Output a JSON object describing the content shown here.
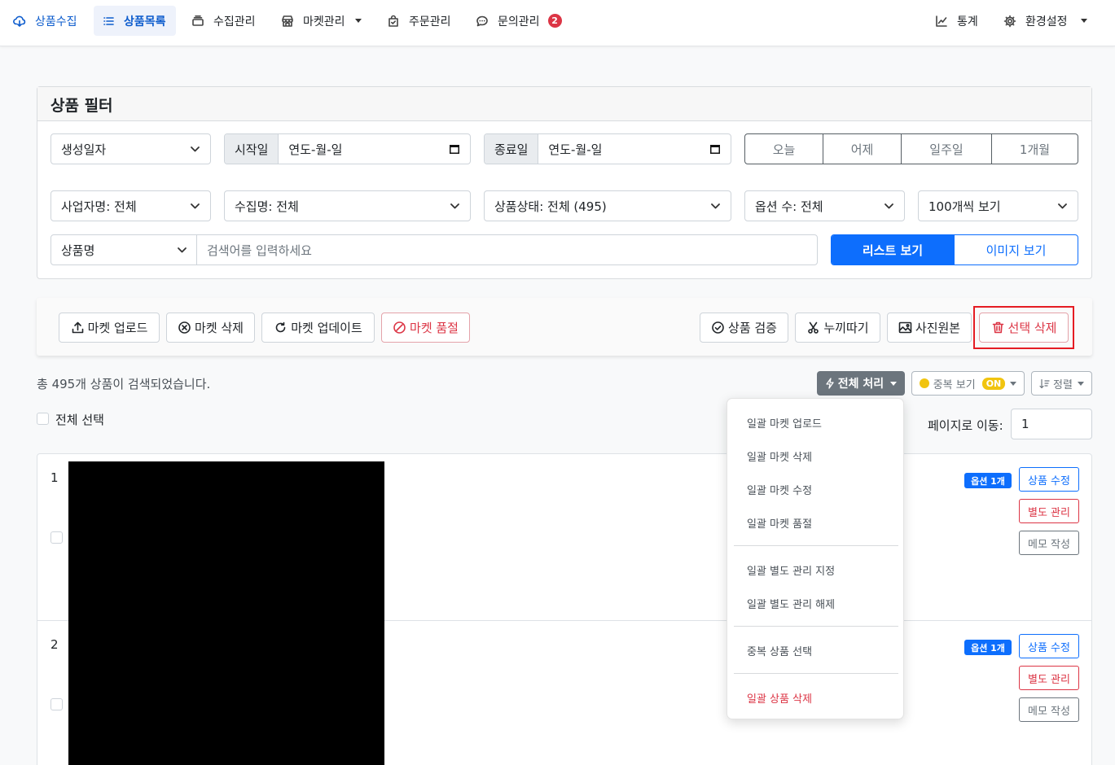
{
  "nav": {
    "items": [
      {
        "label": "상품수집",
        "icon": "cloud-download-icon"
      },
      {
        "label": "상품목록",
        "icon": "list-icon"
      },
      {
        "label": "수집관리",
        "icon": "stack-icon"
      },
      {
        "label": "마켓관리",
        "icon": "shop-icon"
      },
      {
        "label": "주문관리",
        "icon": "bag-check-icon"
      },
      {
        "label": "문의관리",
        "icon": "chat-dots-icon",
        "badge": "2"
      }
    ],
    "right": [
      {
        "label": "통계",
        "icon": "graph-up-icon"
      },
      {
        "label": "환경설정",
        "icon": "gear-icon"
      }
    ]
  },
  "filter": {
    "title": "상품 필터",
    "date_type": "생성일자",
    "start_label": "시작일",
    "start_value": "연도-월-일",
    "end_label": "종료일",
    "end_value": "연도-월-일",
    "quick_ranges": [
      "오늘",
      "어제",
      "일주일",
      "1개월"
    ],
    "business": "사업자명: 전체",
    "collection": "수집명: 전체",
    "status": "상품상태: 전체 (495)",
    "options": "옵션 수: 전체",
    "per_page": "100개씩 보기",
    "search_field": "상품명",
    "search_placeholder": "검색어를 입력하세요",
    "view_list": "리스트 보기",
    "view_image": "이미지 보기"
  },
  "actions": {
    "market_upload": "마켓 업로드",
    "market_delete": "마켓 삭제",
    "market_update": "마켓 업데이트",
    "market_soldout": "마켓 품절",
    "verify": "상품 검증",
    "cutout": "누끼따기",
    "original_photo": "사진원본",
    "delete_selected": "선택 삭제"
  },
  "results": {
    "count_text": "총 495개 상품이 검색되었습니다.",
    "bulk_label": "전체 처리",
    "dup_label": "중복 보기",
    "dup_state": "ON",
    "sort_label": "정렬",
    "select_all": "전체 선택",
    "page_move_label": "페이지로 이동:",
    "page_value": "1"
  },
  "bulk_menu": {
    "group1": [
      "일괄 마켓 업로드",
      "일괄 마켓 삭제",
      "일괄 마켓 수정",
      "일괄 마켓 품절"
    ],
    "group2": [
      "일괄 별도 관리 지정",
      "일괄 별도 관리 해제"
    ],
    "group3": [
      "중복 상품 선택"
    ],
    "danger": "일괄 상품 삭제"
  },
  "products": [
    {
      "num": "1",
      "option_badge": "옵션 1개",
      "edit": "상품 수정",
      "separate": "별도 관리",
      "memo": "메모 작성"
    },
    {
      "num": "2",
      "option_badge": "옵션 1개",
      "edit": "상품 수정",
      "separate": "별도 관리",
      "memo": "메모 작성"
    }
  ]
}
